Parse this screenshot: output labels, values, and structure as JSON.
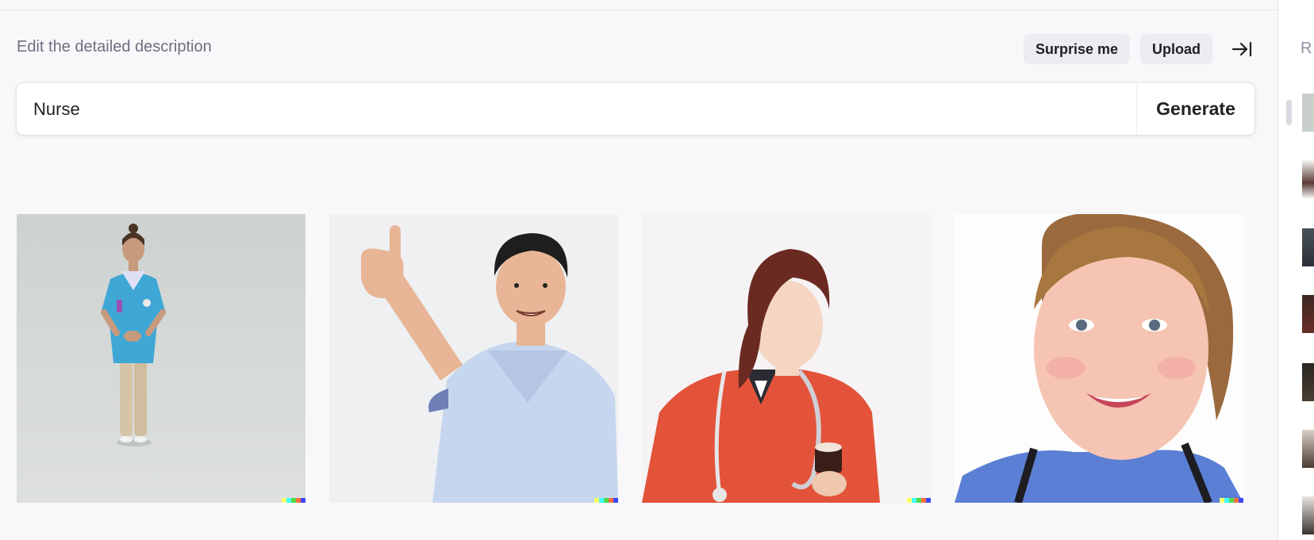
{
  "editor": {
    "heading": "Edit the detailed description",
    "surprise_label": "Surprise me",
    "upload_label": "Upload",
    "prompt_value": "Nurse",
    "generate_label": "Generate"
  },
  "results": [
    {
      "subject": "Woman in turquoise scrubs standing, full body"
    },
    {
      "subject": "Smiling man in light blue scrubs giving thumbs up"
    },
    {
      "subject": "Young woman in red coat with stethoscope holding a cupcake"
    },
    {
      "subject": "Smiling woman in blue scrubs, close-up portrait"
    }
  ],
  "signature_colors": [
    "#ffff66",
    "#42ffff",
    "#51da4c",
    "#ff6e3c",
    "#3c46ff"
  ],
  "history": {
    "heading": "R",
    "thumb_count": 7
  }
}
